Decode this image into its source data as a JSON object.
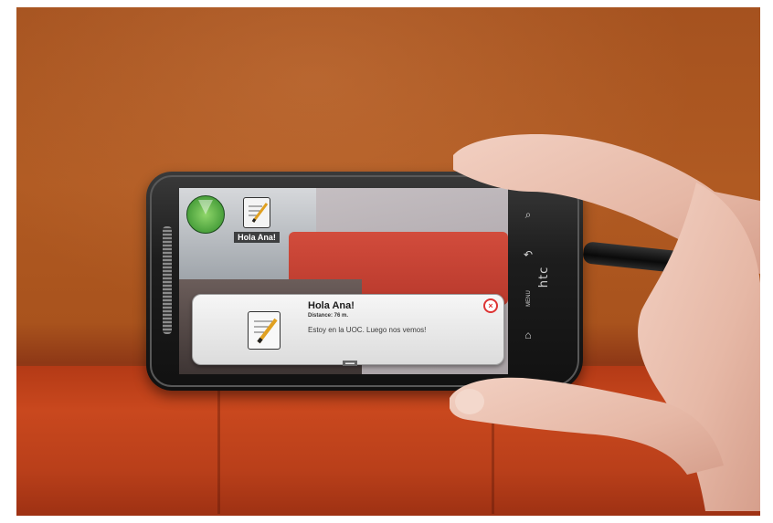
{
  "scene": {
    "subject": "hand holding smartphone running an augmented reality app"
  },
  "ar_app": {
    "marker": {
      "icon": "notepad-pencil-icon",
      "label": "Hola Ana!"
    },
    "popup": {
      "title": "Hola Ana!",
      "distance": "Distance: 76 m.",
      "message": "Estoy en la UOC. Luego nos vemos!",
      "close_icon": "close-x-icon",
      "icon": "notepad-pencil-icon"
    },
    "radar": {
      "icon": "radar-icon"
    }
  },
  "phone": {
    "brand": "htc",
    "keys": {
      "search": "search-icon",
      "back": "back-arrow-icon",
      "menu": "MENU",
      "home": "home-icon"
    }
  },
  "colors": {
    "wall": "#a5521f",
    "sofa": "#c5451d",
    "popup_bg": "#eeeeee",
    "radar_green": "#4aa03c",
    "close_red": "#dd3333"
  }
}
